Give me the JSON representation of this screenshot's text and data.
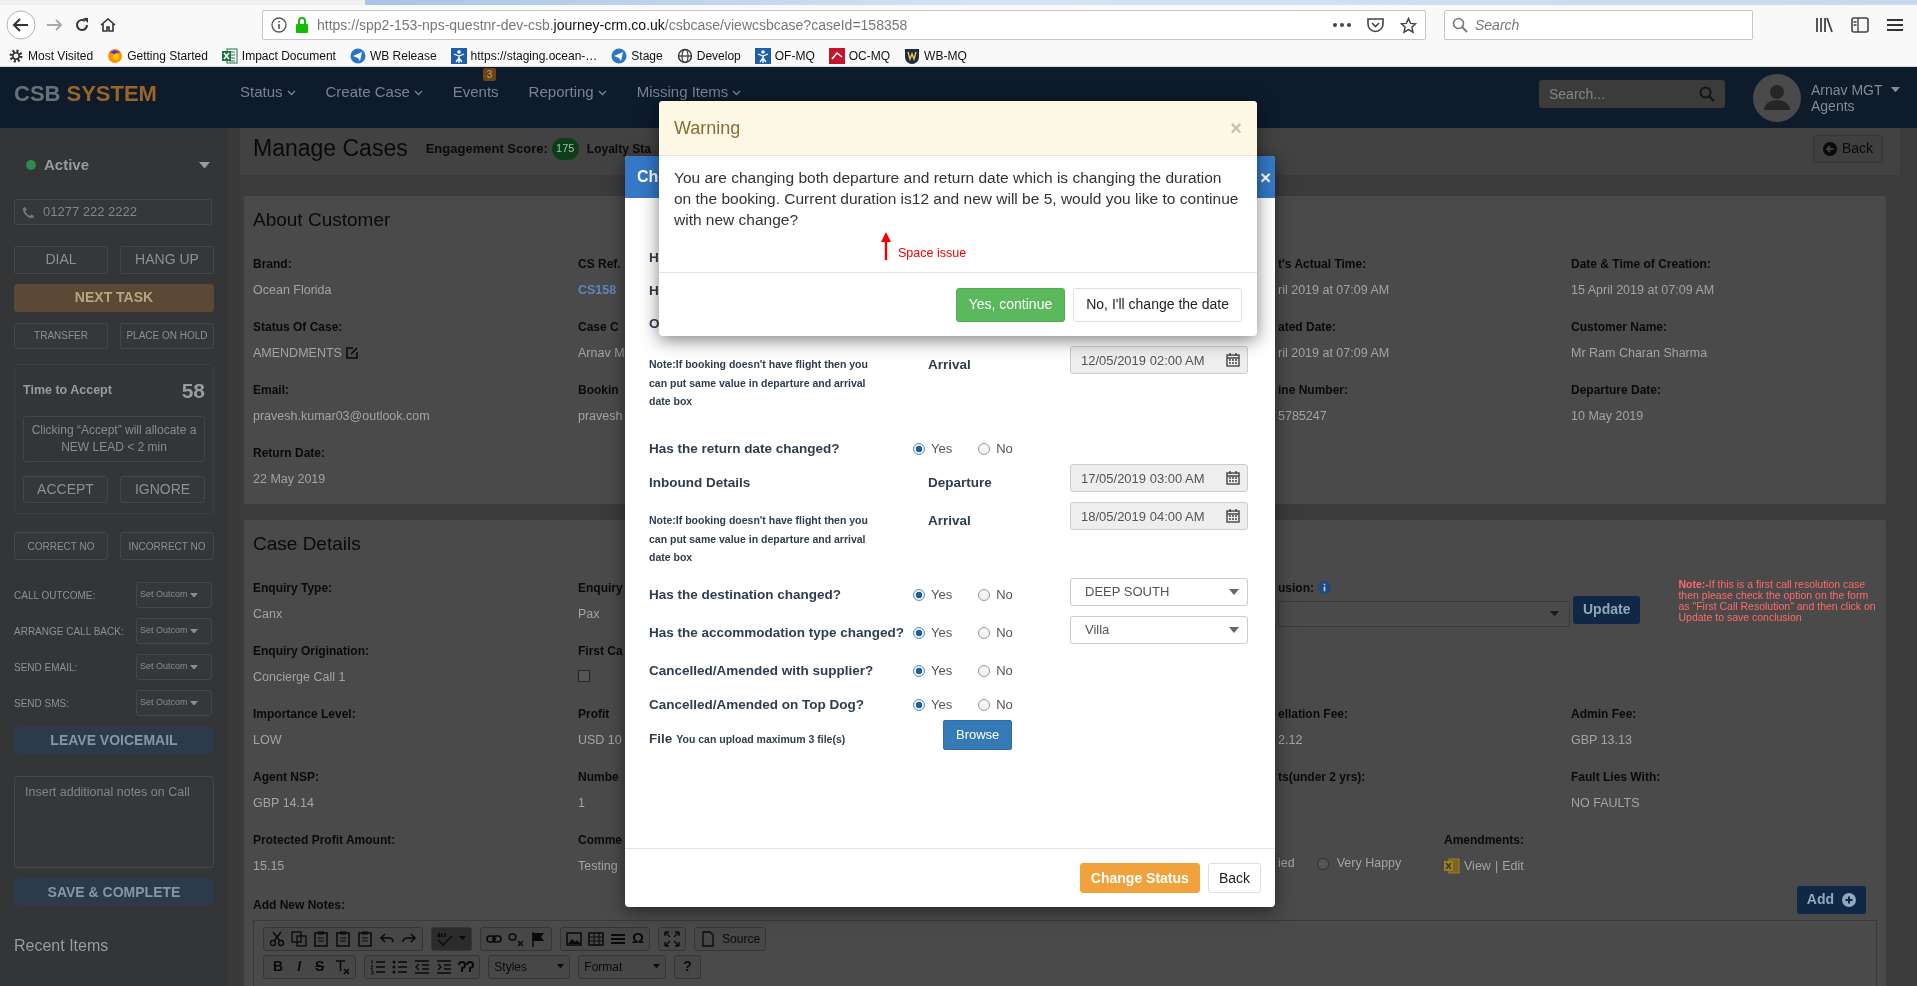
{
  "browser": {
    "url": {
      "start": "https://spp2-153-nps-questnr-dev-csb.",
      "domain": "journey-crm.co.uk",
      "path": "/csbcase/viewcsbcase?caseId=158358"
    },
    "search_placeholder": "Search",
    "bookmarks": [
      {
        "label": "Most Visited",
        "kind": "gear"
      },
      {
        "label": "Getting Started",
        "kind": "browser"
      },
      {
        "label": "Impact Document",
        "kind": "sheet"
      },
      {
        "label": "WB Release",
        "kind": "plane"
      },
      {
        "label": "https://staging.ocean-…",
        "kind": "figure"
      },
      {
        "label": "Stage",
        "kind": "plane"
      },
      {
        "label": "Develop",
        "kind": "globe"
      },
      {
        "label": "OF-MQ",
        "kind": "figure"
      },
      {
        "label": "OC-MQ",
        "kind": "crest"
      },
      {
        "label": "WB-MQ",
        "kind": "shield"
      }
    ]
  },
  "navbar": {
    "logo": {
      "first": "CSB",
      "second": "SYSTEM"
    },
    "menu": [
      {
        "label": "Status",
        "dropdown": true
      },
      {
        "label": "Create Case",
        "dropdown": true
      },
      {
        "label": "Events",
        "dropdown": false,
        "badge": "3"
      },
      {
        "label": "Reporting",
        "dropdown": true
      },
      {
        "label": "Missing Items",
        "dropdown": true
      }
    ],
    "search_placeholder": "Search...",
    "user": {
      "name": "Arnav MGT",
      "role": "Agents"
    }
  },
  "sidebar": {
    "status": "Active",
    "phone_placeholder": "01277 222 2222",
    "call_buttons": [
      "DIAL",
      "HANG UP"
    ],
    "next_task": "NEXT TASK",
    "hold_buttons": [
      "TRANSFER",
      "PLACE ON HOLD"
    ],
    "accept_panel": {
      "title": "Time to Accept",
      "count": "58",
      "info": "Clicking “Accept” will allocate a NEW LEAD < 2 min",
      "buttons": [
        "ACCEPT",
        "IGNORE"
      ]
    },
    "number_buttons": [
      "CORRECT NO",
      "INCORRECT NO"
    ],
    "actions": [
      {
        "label": "CALL OUTCOME:",
        "select": "Set Outcom"
      },
      {
        "label": "ARRANGE CALL BACK:",
        "select": "Set Outcom"
      },
      {
        "label": "SEND EMAIL:",
        "select": "Set Outcom"
      },
      {
        "label": "SEND SMS:",
        "select": "Set Outcom"
      }
    ],
    "voicemail": "LEAVE VOICEMAIL",
    "notes_placeholder": "Insert additional notes on Call",
    "save": "SAVE & COMPLETE",
    "recent": "Recent Items"
  },
  "page_header": {
    "title": "Manage Cases",
    "engagement_label": "Engagement Score:",
    "engagement_score": "175",
    "loyalty_label": "Loyalty Sta",
    "back": "Back"
  },
  "about_customer": {
    "title": "About Customer",
    "rows": [
      [
        {
          "label": "Brand:",
          "value": "Ocean Florida"
        },
        {
          "label": "CS Ref.",
          "value": "CS158",
          "kind": "link"
        },
        {
          "label": "t's Actual Time:",
          "value": "ril 2019 at 07:09 AM"
        },
        {
          "label": "Date & Time of Creation:",
          "value": "15 April 2019 at 07:09 AM"
        }
      ],
      [
        {
          "label": "Status Of Case:",
          "value": "AMENDMENTS",
          "kind": "edit"
        },
        {
          "label": "Case C",
          "value": "Arnav M"
        },
        {
          "label": "ated Date:",
          "value": "ril 2019 at 07:09 AM"
        },
        {
          "label": "Customer Name:",
          "value": "Mr Ram Charan Sharma"
        }
      ],
      [
        {
          "label": "Email:",
          "value": "pravesh.kumar03@outlook.com"
        },
        {
          "label": "Bookin",
          "value": "pravesh"
        },
        {
          "label": "ine Number:",
          "value": "5785247"
        },
        {
          "label": "Departure Date:",
          "value": "10 May 2019"
        }
      ],
      [
        {
          "label": "Return Date:",
          "value": "22 May 2019"
        }
      ]
    ]
  },
  "case_details": {
    "title": "Case Details",
    "rows": [
      [
        {
          "label": "Enquiry Type:",
          "value": "Canx"
        },
        {
          "label": "Enquiry",
          "value": "Pax"
        },
        {
          "kind": "conclusion",
          "label": "usion:",
          "button": "Update",
          "note": "**Note:-**If this is a first call resolution case then please check the option on the form as \"First Call Resolution\" and then click on Update to save conclusion"
        }
      ],
      [
        {
          "label": "Enquiry Origination:",
          "value": "Concierge Call 1"
        },
        {
          "label": "First Ca",
          "kind": "checkbox",
          "checked": false
        }
      ],
      [
        {
          "label": "Importance Level:",
          "value": "LOW"
        },
        {
          "label": "Profit",
          "value": "USD 10"
        },
        {
          "label": "ellation Fee:",
          "value": "2.12"
        },
        {
          "label": "Admin Fee:",
          "value": "GBP 13.13"
        }
      ],
      [
        {
          "label": "Agent NSP:",
          "value": "GBP 14.14"
        },
        {
          "label": "Numbe",
          "value": "1"
        },
        {
          "label": "ts(under 2 yrs):"
        },
        {
          "label": "Fault Lies With:",
          "value": "NO FAULTS"
        }
      ],
      [
        {
          "label": "Protected Profit Amount:",
          "value": "15.15"
        },
        {
          "label": "Comme",
          "value": "Testing"
        },
        {
          "kind": "satisfaction",
          "partial": "ied",
          "options": [
            {
              "label": "Very Happy",
              "selected": false
            }
          ],
          "amendments_label": "Amendments:",
          "links": [
            "View",
            "Edit"
          ],
          "separator": "|"
        }
      ]
    ],
    "notes_label": "Add New Notes:",
    "add_button": "Add"
  },
  "editor": {
    "spellcheck_pressed": true,
    "special_char": "Ω",
    "source": "Source",
    "bold": "B",
    "italic": "I",
    "strike": "S",
    "styles": "Styles",
    "format": "Format",
    "help": "?"
  },
  "change_status": {
    "title": "Ch",
    "close": "×",
    "rows": [
      {
        "kind": "partial",
        "label": "H"
      },
      {
        "kind": "partial",
        "label": "H"
      },
      {
        "kind": "partial",
        "label": "O"
      },
      {
        "kind": "note",
        "note": "Note:If booking doesn't have flight then you can put same value in departure and arrival date box",
        "field_label": "Arrival",
        "value": "12/05/2019 02:00 AM"
      },
      {
        "kind": "question",
        "label": "Has the return date changed?",
        "options": [
          {
            "label": "Yes",
            "selected": true
          },
          {
            "label": "No",
            "selected": false
          }
        ]
      },
      {
        "kind": "section",
        "label": "Inbound Details",
        "field_label": "Departure",
        "value": "17/05/2019 03:00 AM"
      },
      {
        "kind": "note",
        "note": "Note:If booking doesn't have flight then you can put same value in departure and arrival date box",
        "field_label": "Arrival",
        "value": "18/05/2019 04:00 AM"
      },
      {
        "kind": "question",
        "label": "Has the destination changed?",
        "options": [
          {
            "label": "Yes",
            "selected": true
          },
          {
            "label": "No",
            "selected": false
          }
        ],
        "select": "DEEP SOUTH"
      },
      {
        "kind": "question",
        "label": "Has the accommodation type changed?",
        "options": [
          {
            "label": "Yes",
            "selected": true
          },
          {
            "label": "No",
            "selected": false
          }
        ],
        "select": "Villa"
      },
      {
        "kind": "question",
        "label": "Cancelled/Amended with supplier?",
        "options": [
          {
            "label": "Yes",
            "selected": true
          },
          {
            "label": "No",
            "selected": false
          }
        ]
      },
      {
        "kind": "question",
        "label": "Cancelled/Amended on Top Dog?",
        "options": [
          {
            "label": "Yes",
            "selected": true
          },
          {
            "label": "No",
            "selected": false
          }
        ]
      },
      {
        "kind": "file",
        "label": "File",
        "hint": "You can upload maximum 3 file(s)",
        "button": "Browse"
      }
    ],
    "buttons": [
      {
        "label": "Change Status",
        "kind": "warning"
      },
      {
        "label": "Back",
        "kind": "default"
      }
    ]
  },
  "warning": {
    "title": "Warning",
    "close": "×",
    "message": "You are changing both departure and return date which is changing the duration on the booking. Current duration is12 and new will be 5, would you like to continue with new change?",
    "annotation": "Space issue",
    "buttons": [
      {
        "label": "Yes, continue",
        "kind": "success"
      },
      {
        "label": "No, I'll change the date",
        "kind": "default"
      }
    ]
  }
}
